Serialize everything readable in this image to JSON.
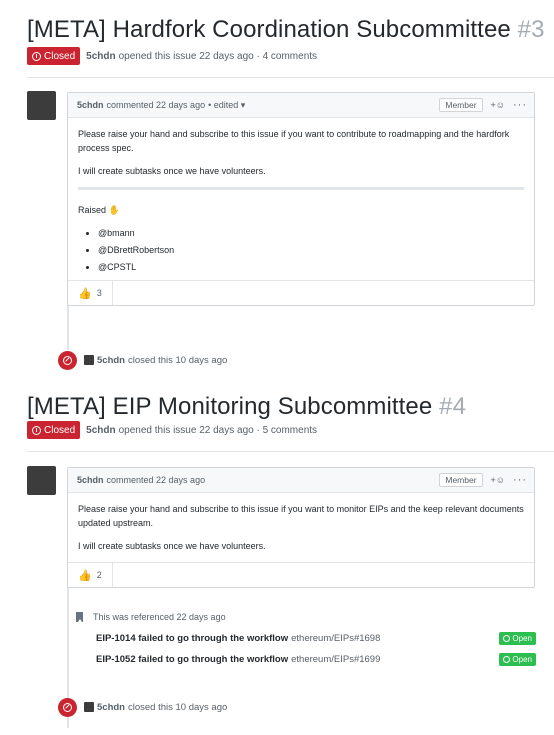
{
  "issues": [
    {
      "title": "[META] Hardfork Coordination Subcommittee",
      "number": "#3",
      "state": "Closed",
      "author": "5chdn",
      "meta": "opened this issue 22 days ago · 4 comments",
      "comment": {
        "author": "5chdn",
        "time": "commented 22 days ago",
        "edited": "• edited ▾",
        "role": "Member",
        "paragraphs": [
          "Please raise your hand and subscribe to this issue if you want to contribute to roadmapping and the hardfork process spec.",
          "I will create subtasks once we have volunteers."
        ],
        "raised_label": "Raised ✋",
        "raised_list": [
          "@bmann",
          "@DBrettRobertson",
          "@CPSTL"
        ],
        "reaction_count": "3"
      },
      "closed_event": {
        "user": "5chdn",
        "text": "closed this 10 days ago"
      }
    },
    {
      "title": "[META] EIP Monitoring Subcommittee",
      "number": "#4",
      "state": "Closed",
      "author": "5chdn",
      "meta": "opened this issue 22 days ago · 5 comments",
      "comment": {
        "author": "5chdn",
        "time": "commented 22 days ago",
        "role": "Member",
        "paragraphs": [
          "Please raise your hand and subscribe to this issue if you want to monitor EIPs and the keep relevant documents updated upstream.",
          "I will create subtasks once we have volunteers."
        ],
        "reaction_count": "2"
      },
      "reference": {
        "text": "This was referenced 22 days ago",
        "items": [
          {
            "title": "EIP-1014 failed to go through the workflow",
            "repo": "ethereum/EIPs#1698",
            "state": "Open"
          },
          {
            "title": "EIP-1052 failed to go through the workflow",
            "repo": "ethereum/EIPs#1699",
            "state": "Open"
          }
        ]
      },
      "closed_event": {
        "user": "5chdn",
        "text": "closed this 10 days ago"
      }
    }
  ],
  "icons": {
    "react": "+☺",
    "more": "···",
    "thumbs_up": "👍"
  },
  "colors": {
    "closed": "#cb2431",
    "open": "#2cbe4e",
    "muted": "#586069"
  }
}
